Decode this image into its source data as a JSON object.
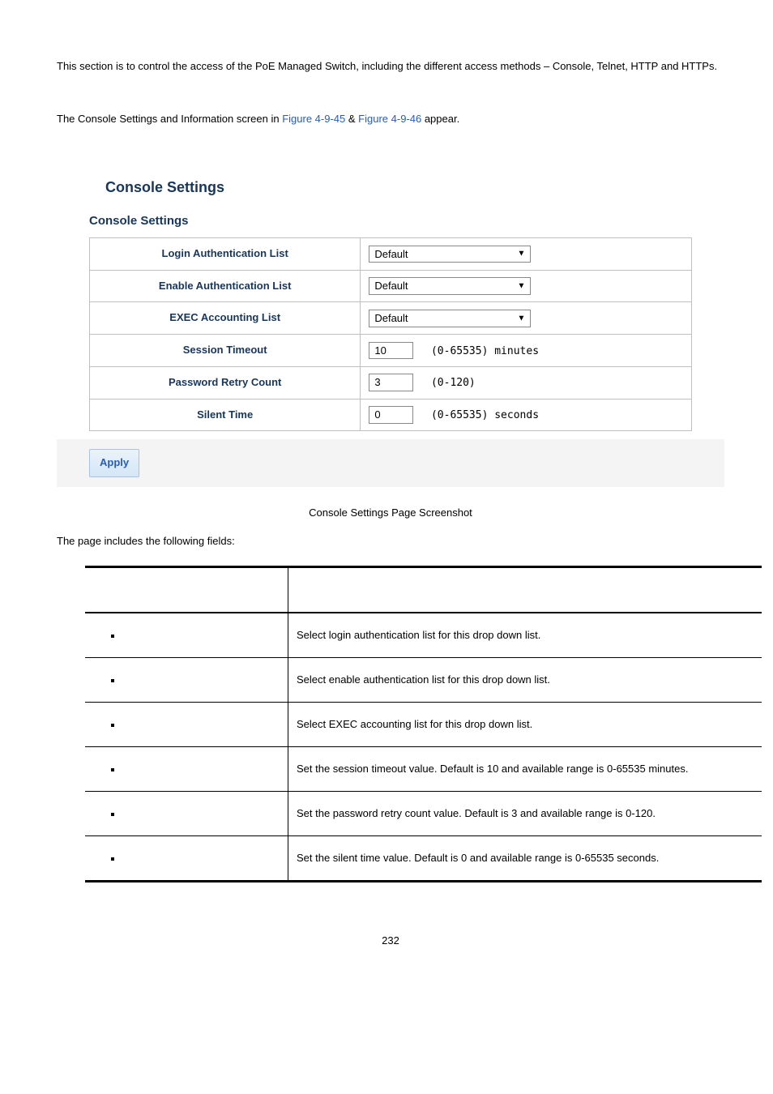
{
  "intro1": "This section is to control the access of the PoE Managed Switch, including the different access methods – Console, Telnet, HTTP and HTTPs.",
  "intro2_pre": "The Console Settings and Information screen in ",
  "intro2_link1": "Figure 4-9-45",
  "intro2_amp": " & ",
  "intro2_link2": "Figure 4-9-46",
  "intro2_post": " appear.",
  "screenshot": {
    "title": "Console Settings",
    "subtitle": "Console Settings",
    "rows": [
      {
        "label": "Login Authentication List",
        "kind": "select",
        "value": "Default"
      },
      {
        "label": "Enable Authentication List",
        "kind": "select",
        "value": "Default"
      },
      {
        "label": "EXEC Accounting List",
        "kind": "select",
        "value": "Default"
      },
      {
        "label": "Session Timeout",
        "kind": "number",
        "value": "10",
        "unit": "(0-65535) minutes"
      },
      {
        "label": "Password Retry Count",
        "kind": "number",
        "value": "3",
        "unit": "(0-120)"
      },
      {
        "label": "Silent Time",
        "kind": "number",
        "value": "0",
        "unit": "(0-65535) seconds"
      }
    ],
    "apply_btn": "Apply"
  },
  "figure_label": " Console Settings Page Screenshot",
  "page_includes": "The page includes the following fields:",
  "fields": [
    {
      "desc": "Select login authentication list for this drop down list."
    },
    {
      "desc": "Select enable authentication list for this drop down list."
    },
    {
      "desc": "Select EXEC accounting list for this drop down list."
    },
    {
      "desc": "Set the session timeout value. Default is 10 and available range is 0-65535 minutes."
    },
    {
      "desc": "Set the password retry count value. Default is 3 and available range is 0-120."
    },
    {
      "desc": "Set the silent time value. Default is 0 and available range is 0-65535 seconds."
    }
  ],
  "page_number": "232"
}
